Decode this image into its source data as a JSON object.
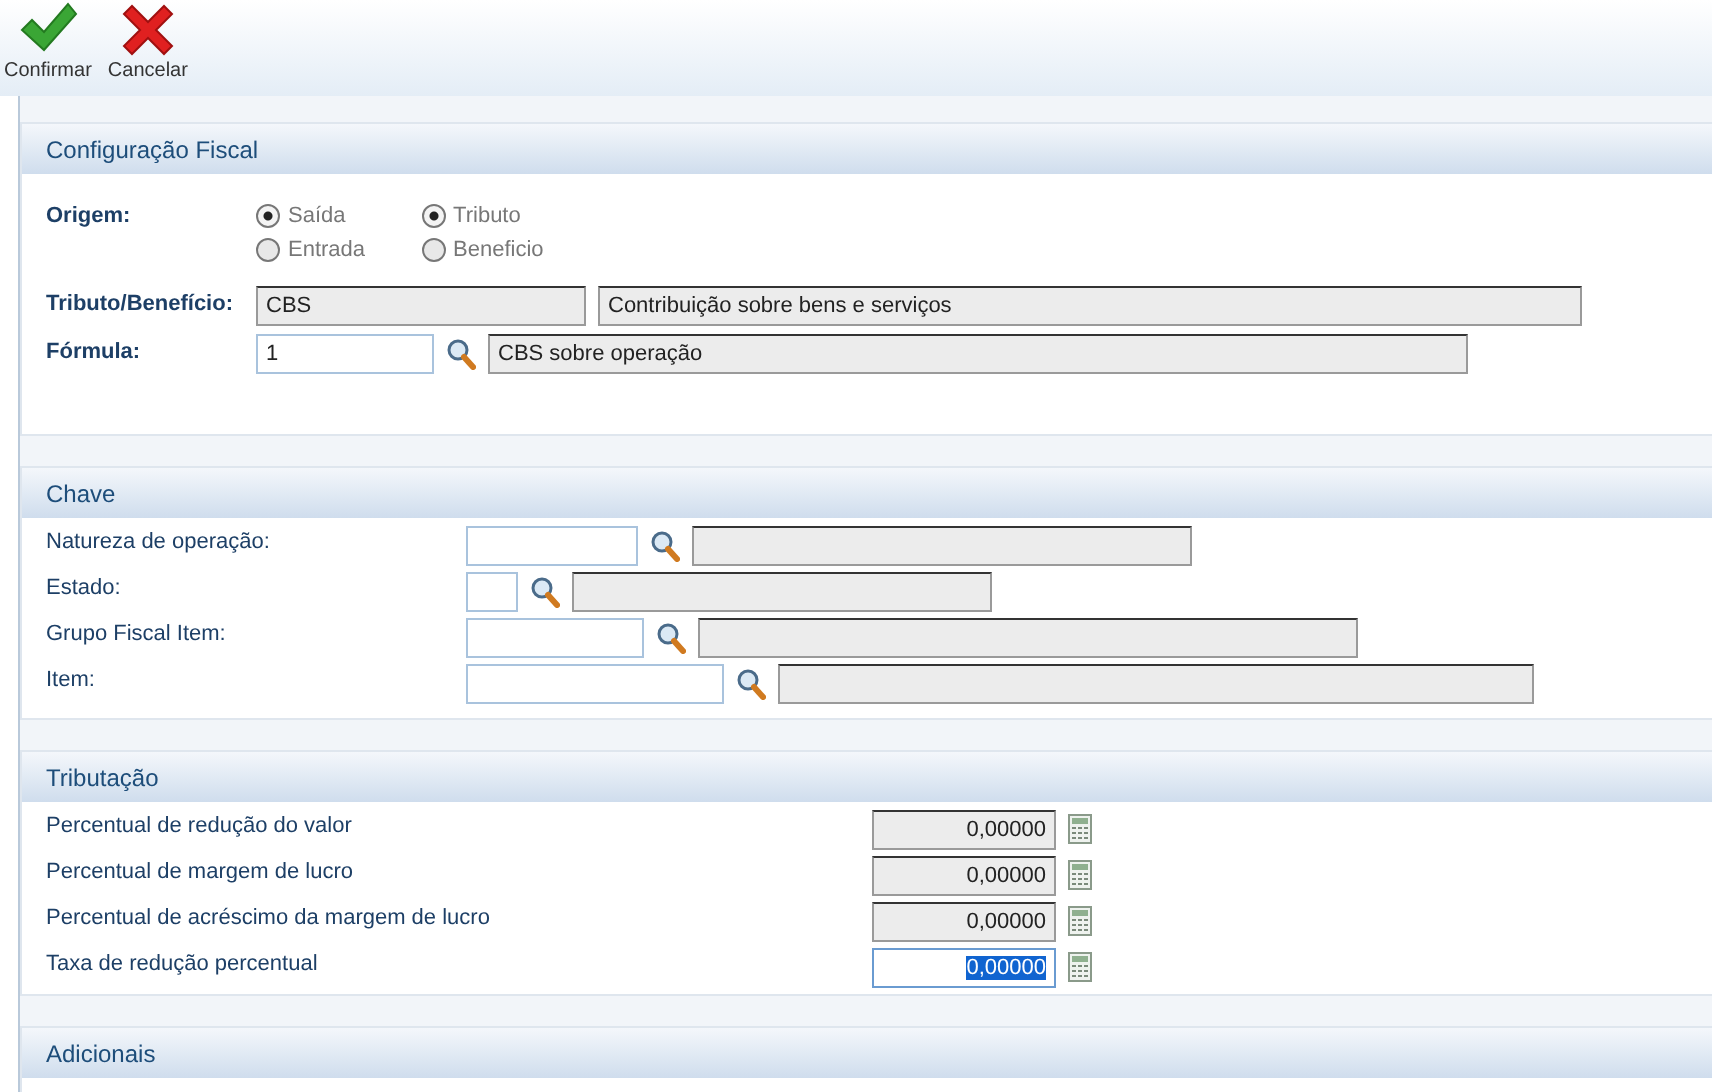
{
  "toolbar": [
    {
      "kind": "confirm",
      "label": "Confirmar"
    },
    {
      "kind": "cancel",
      "label": "Cancelar"
    }
  ],
  "config": {
    "title": "Configuração Fiscal",
    "origem": {
      "label": "Origem:",
      "groups": [
        [
          {
            "label": "Saída",
            "selected": true
          },
          {
            "label": "Entrada",
            "selected": false
          }
        ],
        [
          {
            "label": "Tributo",
            "selected": true
          },
          {
            "label": "Beneficio",
            "selected": false
          }
        ]
      ]
    },
    "tributo": {
      "label": "Tributo/Benefício:",
      "code": "CBS",
      "description": "Contribuição sobre bens e serviços"
    },
    "formula": {
      "label": "Fórmula:",
      "value": "1",
      "description": "CBS sobre operação"
    }
  },
  "chave": {
    "title": "Chave",
    "rows": [
      {
        "label": "Natureza de operação:"
      },
      {
        "label": "Estado:"
      },
      {
        "label": "Grupo Fiscal Item:"
      },
      {
        "label": "Item:"
      }
    ]
  },
  "tributacao": {
    "title": "Tributação",
    "rows": [
      {
        "label": "Percentual de redução do valor",
        "value": "0,00000",
        "editable": false,
        "focused": false
      },
      {
        "label": "Percentual de margem de lucro",
        "value": "0,00000",
        "editable": false,
        "focused": false
      },
      {
        "label": "Percentual de acréscimo da margem de lucro",
        "value": "0,00000",
        "editable": false,
        "focused": false
      },
      {
        "label": "Taxa de redução percentual",
        "value": "0,00000",
        "editable": true,
        "focused": true
      }
    ]
  },
  "adicionais": {
    "title": "Adicionais"
  }
}
